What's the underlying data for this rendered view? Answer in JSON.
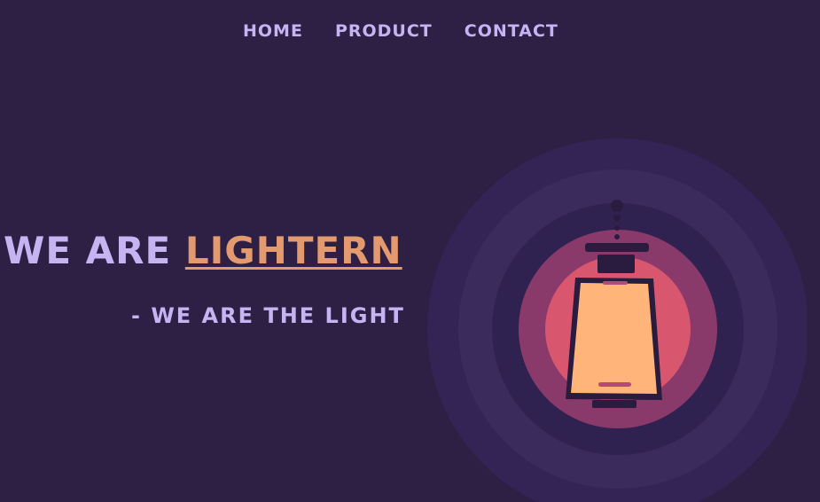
{
  "nav": {
    "items": [
      {
        "label": "HOME"
      },
      {
        "label": "PRODUCT"
      },
      {
        "label": "CONTACT"
      }
    ]
  },
  "hero": {
    "headline_prefix": "WE ARE",
    "brand": "LIGHTERN",
    "tagline": "- WE ARE THE LIGHT"
  },
  "colors": {
    "background": "#2e1f45",
    "text": "#c7b2f2",
    "brand": "#e39a6e",
    "glow_outer": "#3a2b5c",
    "glow_mid": "#8a3a6a",
    "glow_inner": "#d9566f",
    "lantern_body": "#ffb47a",
    "lantern_frame": "#2a1c3f"
  },
  "illustration": {
    "icon": "lantern-icon"
  }
}
